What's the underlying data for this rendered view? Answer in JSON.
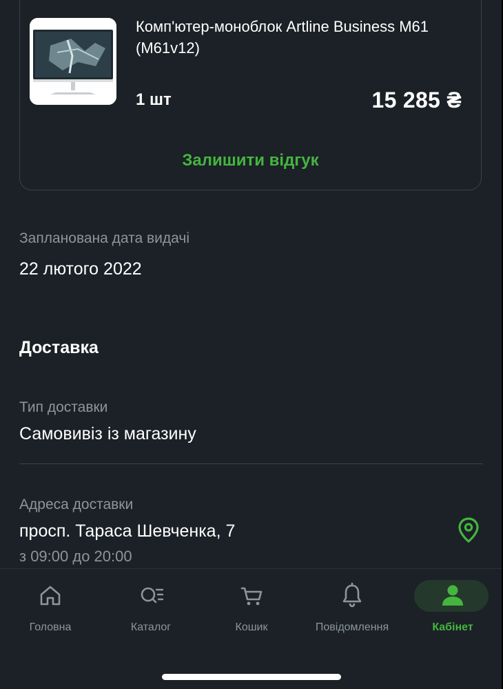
{
  "product": {
    "title": "Комп'ютер-моноблок Artline Business M61 (M61v12)",
    "quantity": "1 шт",
    "price": "15 285 ₴",
    "review_link": "Залишити відгук"
  },
  "pickup": {
    "label": "Запланована дата видачі",
    "date": "22 лютого 2022"
  },
  "delivery": {
    "section_title": "Доставка",
    "type_label": "Тип доставки",
    "type_value": "Самовивіз із магазину",
    "address_label": "Адреса доставки",
    "address_value": "просп. Тараса Шевченка, 7",
    "hours": "з 09:00 до 20:00",
    "pin_icon": "map-pin-icon"
  },
  "tabbar": {
    "tabs": [
      {
        "label": "Головна",
        "icon": "home-icon",
        "active": false
      },
      {
        "label": "Каталог",
        "icon": "catalog-search-icon",
        "active": false
      },
      {
        "label": "Кошик",
        "icon": "cart-icon",
        "active": false
      },
      {
        "label": "Повідомлення",
        "icon": "bell-icon",
        "active": false
      },
      {
        "label": "Кабінет",
        "icon": "user-icon",
        "active": true
      }
    ]
  },
  "colors": {
    "background": "#1b2126",
    "accent": "#45b53f",
    "muted_text": "#8d969d",
    "border": "#3a4249"
  }
}
